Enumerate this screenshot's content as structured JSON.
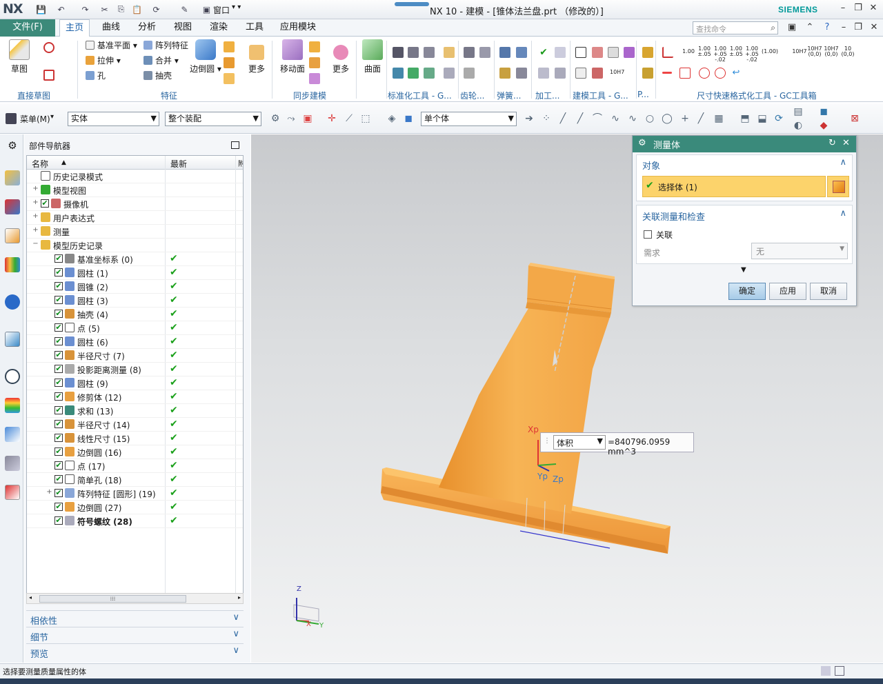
{
  "titlebar": {
    "logo": "NX",
    "window_menu": "窗口",
    "title": "NX 10 - 建模 - [锥体法兰盘.prt （修改的）]",
    "brand": "SIEMENS"
  },
  "menu": {
    "file": "文件(F)",
    "tabs": [
      "主页",
      "曲线",
      "分析",
      "视图",
      "渲染",
      "工具",
      "应用模块"
    ],
    "search_placeholder": "查找命令"
  },
  "ribbon": {
    "sketch": "草图",
    "sketch_group": "直接草图",
    "datum_plane": "基准平面",
    "extrude": "拉伸",
    "hole": "孔",
    "pattern": "阵列特征",
    "unite": "合并",
    "shell": "抽壳",
    "edge_blend": "边倒圆",
    "more1": "更多",
    "feature_group": "特征",
    "move_face": "移动面",
    "more2": "更多",
    "sync_group": "同步建模",
    "surface": "曲面",
    "std_group": "标准化工具 - G...",
    "gear_group": "齿轮...",
    "spring_group": "弹簧...",
    "machining_group": "加工...",
    "build_group": "建模工具 - G...",
    "p_group": "P...",
    "dim_group": "尺寸快速格式化工具 - GC工具箱",
    "dim_labels": [
      "1.00",
      "1.00\n±.05",
      "1.00\n+.05\n-.02",
      "1.00\n±.05",
      "1.00\n+.05\n-.02",
      "(1.00)",
      "10H7",
      "10H7\n(0,0)",
      "10H7\n(0,0)",
      "10\n(0,0)"
    ],
    "dim_label_h7": "10H7"
  },
  "toolbar2": {
    "menu": "菜单(M)",
    "filter": "实体",
    "scope": "整个装配",
    "select_mode": "单个体"
  },
  "nav": {
    "title": "部件导航器",
    "col_name": "名称",
    "col_latest": "最新",
    "col_more": "附",
    "rows": [
      {
        "label": "历史记录模式"
      },
      {
        "label": "模型视图"
      },
      {
        "label": "摄像机"
      },
      {
        "label": "用户表达式"
      },
      {
        "label": "测量"
      },
      {
        "label": "模型历史记录"
      },
      {
        "label": "基准坐标系 (0)"
      },
      {
        "label": "圆柱 (1)"
      },
      {
        "label": "圆锥 (2)"
      },
      {
        "label": "圆柱 (3)"
      },
      {
        "label": "抽壳 (4)"
      },
      {
        "label": "点 (5)"
      },
      {
        "label": "圆柱 (6)"
      },
      {
        "label": "半径尺寸 (7)"
      },
      {
        "label": "投影距离测量 (8)"
      },
      {
        "label": "圆柱 (9)"
      },
      {
        "label": "修剪体 (12)"
      },
      {
        "label": "求和 (13)"
      },
      {
        "label": "半径尺寸 (14)"
      },
      {
        "label": "线性尺寸 (15)"
      },
      {
        "label": "边倒圆 (16)"
      },
      {
        "label": "点 (17)"
      },
      {
        "label": "简单孔 (18)"
      },
      {
        "label": "阵列特征 [圆形] (19)"
      },
      {
        "label": "边倒圆 (27)"
      },
      {
        "label": "符号螺纹 (28)"
      }
    ],
    "sections": [
      "相依性",
      "细节",
      "预览"
    ]
  },
  "dialog": {
    "title": "测量体",
    "object_section": "对象",
    "select_body": "选择体 (1)",
    "assoc_section": "关联测量和检查",
    "assoc_label": "关联",
    "req_label": "需求",
    "req_value": "无",
    "ok": "确定",
    "apply": "应用",
    "cancel": "取消"
  },
  "measure": {
    "type": "体积",
    "value": "=840796.0959 mm^3"
  },
  "axes": {
    "xp": "Xp",
    "yp": "Yp",
    "zp": "Zp",
    "x": "X",
    "y": "Y",
    "z": "Z"
  },
  "status": {
    "text": "选择要测量质量属性的体"
  },
  "colors": {
    "accent": "#3c8a7a",
    "part": "#f4a042",
    "check": "#1aa01a"
  }
}
